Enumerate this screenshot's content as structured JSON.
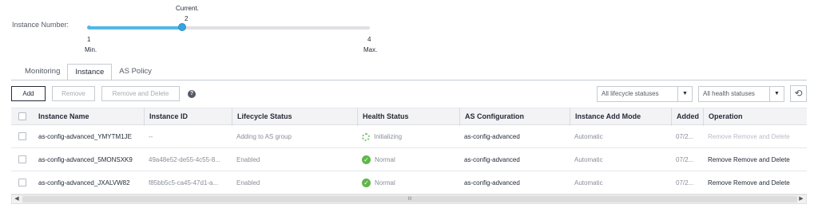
{
  "slider": {
    "label": "Instance Number:",
    "current_label": "Current.",
    "current_value": "2",
    "min_value": "1",
    "min_label": "Min.",
    "max_value": "4",
    "max_label": "Max.",
    "current": 2,
    "min": 1,
    "max": 4
  },
  "tabs": [
    {
      "label": "Monitoring",
      "active": false
    },
    {
      "label": "Instance",
      "active": true
    },
    {
      "label": "AS Policy",
      "active": false
    }
  ],
  "toolbar": {
    "add_label": "Add",
    "remove_label": "Remove",
    "remove_delete_label": "Remove and Delete",
    "help_icon": "?",
    "lifecycle_filter": "All lifecycle statuses",
    "health_filter": "All health statuses",
    "refresh_icon": "refresh-icon"
  },
  "table": {
    "headers": [
      "Instance Name",
      "Instance ID",
      "Lifecycle Status",
      "Health Status",
      "AS Configuration",
      "Instance Add Mode",
      "Added",
      "Operation"
    ],
    "rows": [
      {
        "name": "as-config-advanced_YMYTM1JE",
        "id": "--",
        "lifecycle": "Adding to AS group",
        "health": "Initializing",
        "health_state": "initializing",
        "config": "as-config-advanced",
        "add_mode": "Automatic",
        "added": "07/2...",
        "op_remove": "Remove",
        "op_remove_delete": "Remove and Delete",
        "ops_enabled": false
      },
      {
        "name": "as-config-advanced_5MONSXK9",
        "id": "49a48e52-de55-4c55-8...",
        "lifecycle": "Enabled",
        "health": "Normal",
        "health_state": "normal",
        "config": "as-config-advanced",
        "add_mode": "Automatic",
        "added": "07/2...",
        "op_remove": "Remove",
        "op_remove_delete": "Remove and Delete",
        "ops_enabled": true
      },
      {
        "name": "as-config-advanced_JXALVW82",
        "id": "f85bb5c5-ca45-47d1-a...",
        "lifecycle": "Enabled",
        "health": "Normal",
        "health_state": "normal",
        "config": "as-config-advanced",
        "add_mode": "Automatic",
        "added": "07/2...",
        "op_remove": "Remove",
        "op_remove_delete": "Remove and Delete",
        "ops_enabled": true
      }
    ]
  },
  "scrollbar": {
    "grip": "III"
  },
  "colors": {
    "accent": "#52b7e6",
    "thumb": "#3aa3dd",
    "normal_status": "#5fb748",
    "initializing_status": "#7bc96f"
  }
}
